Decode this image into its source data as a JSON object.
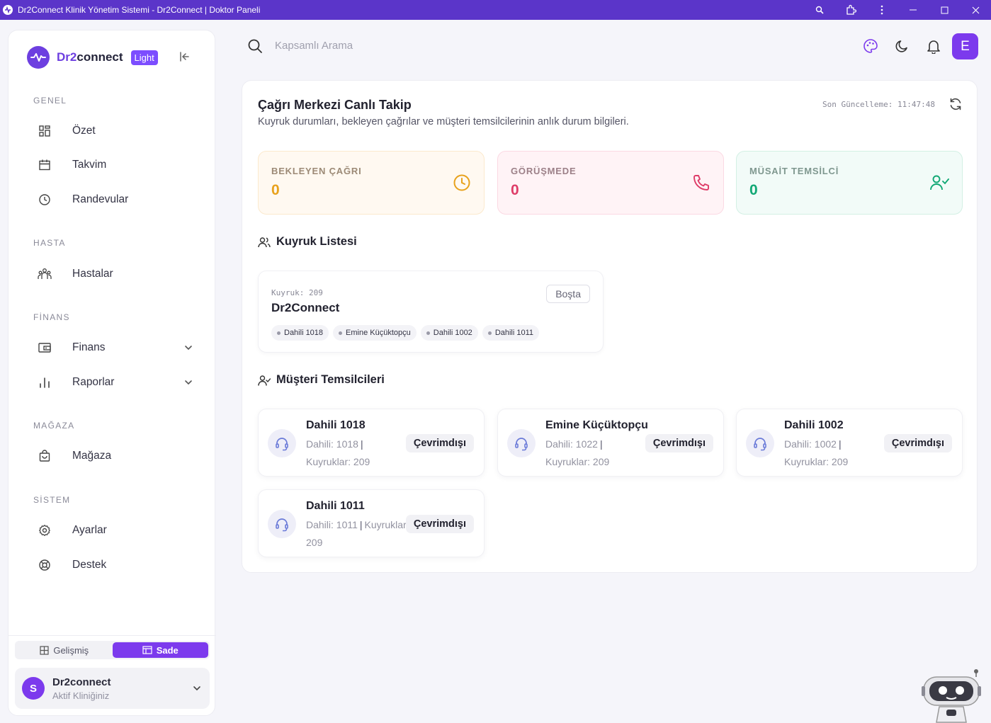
{
  "window": {
    "title": "Dr2Connect Klinik Yönetim Sistemi - Dr2Connect | Doktor Paneli"
  },
  "brand": {
    "name_part1": "Dr2",
    "name_part2": "connect",
    "badge": "Light"
  },
  "sidebar": {
    "sections": [
      {
        "title": "GENEL",
        "items": [
          {
            "label": "Özet",
            "icon": "grid-icon"
          },
          {
            "label": "Takvim",
            "icon": "calendar-icon"
          },
          {
            "label": "Randevular",
            "icon": "clock-icon"
          }
        ]
      },
      {
        "title": "HASTA",
        "items": [
          {
            "label": "Hastalar",
            "icon": "users-icon"
          }
        ]
      },
      {
        "title": "FİNANS",
        "items": [
          {
            "label": "Finans",
            "icon": "wallet-icon"
          },
          {
            "label": "Raporlar",
            "icon": "bar-chart-icon"
          }
        ]
      },
      {
        "title": "MAĞAZA",
        "items": [
          {
            "label": "Mağaza",
            "icon": "shopping-bag-icon"
          }
        ]
      },
      {
        "title": "SİSTEM",
        "items": [
          {
            "label": "Ayarlar",
            "icon": "gear-icon"
          },
          {
            "label": "Destek",
            "icon": "lifebuoy-icon"
          }
        ]
      }
    ],
    "mode_options": {
      "advanced": "Gelişmiş",
      "simple": "Sade",
      "active": "simple"
    },
    "clinic": {
      "avatar": "S",
      "name": "Dr2connect",
      "subtitle": "Aktif Kliniğiniz"
    }
  },
  "topbar": {
    "search_placeholder": "Kapsamlı Arama",
    "user_initial": "E"
  },
  "page": {
    "title": "Çağrı Merkezi Canlı Takip",
    "description": "Kuyruk durumları, bekleyen çağrılar ve müşteri temsilcilerinin anlık durum bilgileri.",
    "last_update": "Son Güncelleme: 11:47:48"
  },
  "colors": {
    "accent": "#7c3aed",
    "waiting": "#e8a21d",
    "in_call": "#de3c68",
    "available": "#12a875"
  },
  "stats": [
    {
      "label": "BEKLEYEN ÇAĞRI",
      "value": "0",
      "icon": "clock-icon"
    },
    {
      "label": "GÖRÜŞMEDE",
      "value": "0",
      "icon": "phone-icon"
    },
    {
      "label": "MÜSAİT TEMSİLCİ",
      "value": "0",
      "icon": "user-check-icon"
    }
  ],
  "queues": {
    "title": "Kuyruk Listesi",
    "items": [
      {
        "number": "Kuyruk: 209",
        "name": "Dr2Connect",
        "status": "Boşta",
        "members": [
          "Dahili 1018",
          "Emine Küçüktopçu",
          "Dahili 1002",
          "Dahili 1011"
        ]
      }
    ]
  },
  "agents": {
    "title": "Müşteri Temsilcileri",
    "items": [
      {
        "name": "Dahili 1018",
        "ext": "Dahili: 1018",
        "queues": "Kuyruklar: 209",
        "status": "Çevrimdışı"
      },
      {
        "name": "Emine Küçüktopçu",
        "ext": "Dahili: 1022",
        "queues": "Kuyruklar: 209",
        "status": "Çevrimdışı"
      },
      {
        "name": "Dahili 1002",
        "ext": "Dahili: 1002",
        "queues": "Kuyruklar: 209",
        "status": "Çevrimdışı"
      },
      {
        "name": "Dahili 1011",
        "ext": "Dahili: 1011",
        "queues": "Kuyruklar: 209",
        "status": "Çevrimdışı"
      }
    ]
  }
}
